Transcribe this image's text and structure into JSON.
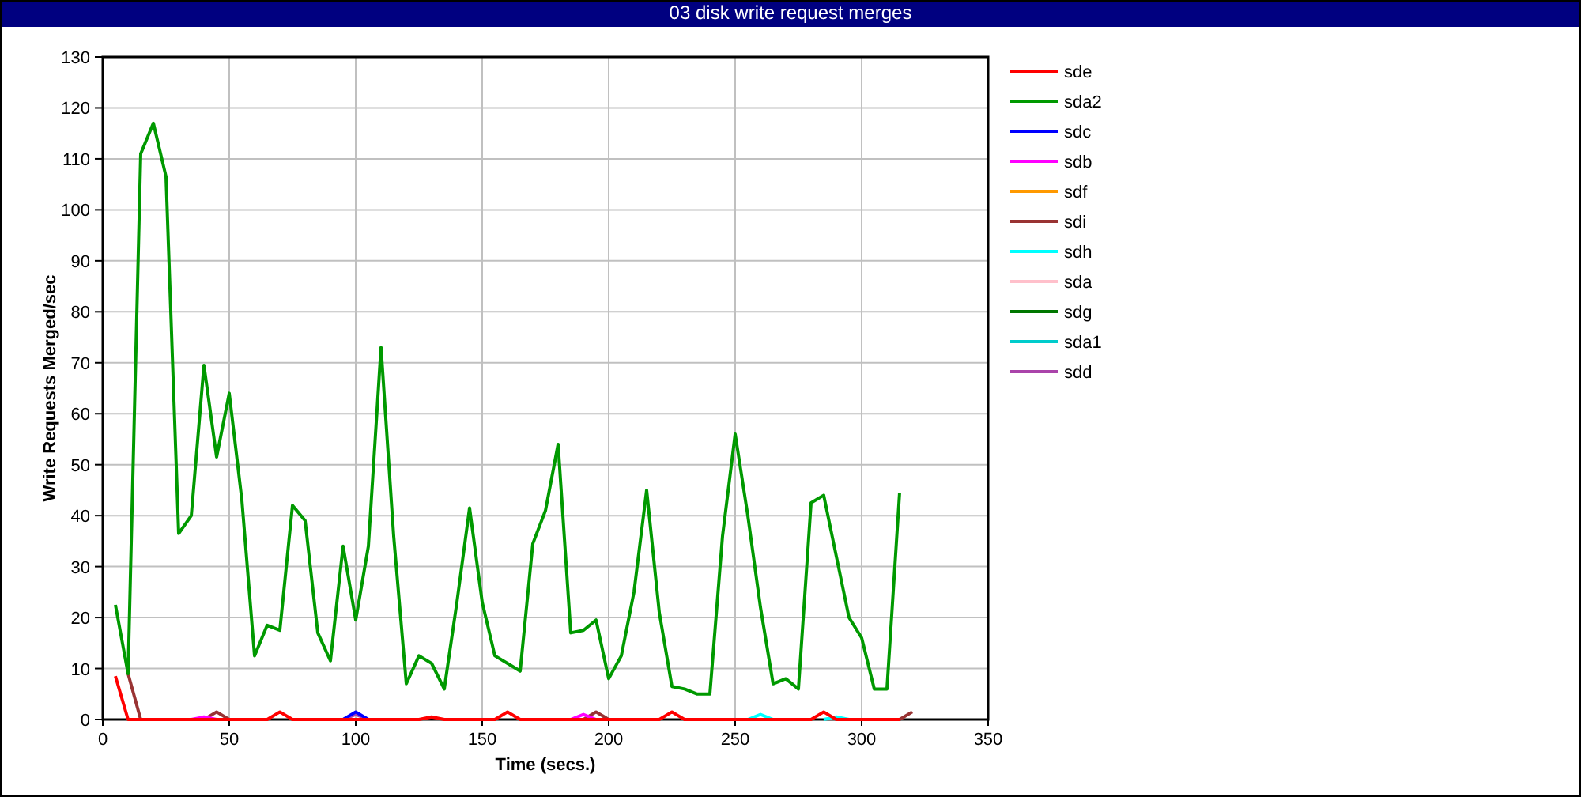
{
  "window": {
    "title": "03 disk write request merges"
  },
  "chart_data": {
    "type": "line",
    "xlabel": "Time (secs.)",
    "ylabel": "Write Requests Merged/sec",
    "xlim": [
      0,
      350
    ],
    "ylim": [
      0,
      130
    ],
    "xticks": [
      0,
      50,
      100,
      150,
      200,
      250,
      300,
      350
    ],
    "yticks": [
      0,
      10,
      20,
      30,
      40,
      50,
      60,
      70,
      80,
      90,
      100,
      110,
      120,
      130
    ],
    "x": [
      5,
      10,
      15,
      20,
      25,
      30,
      35,
      40,
      45,
      50,
      55,
      60,
      65,
      70,
      75,
      80,
      85,
      90,
      95,
      100,
      105,
      110,
      115,
      120,
      125,
      130,
      135,
      140,
      145,
      150,
      155,
      160,
      165,
      170,
      175,
      180,
      185,
      190,
      195,
      200,
      205,
      210,
      215,
      220,
      225,
      230,
      235,
      240,
      245,
      250,
      255,
      260,
      265,
      270,
      275,
      280,
      285,
      290,
      295,
      300,
      305,
      310,
      315,
      320
    ],
    "series": [
      {
        "name": "sde",
        "color": "#ff0000",
        "values": [
          8.5,
          0,
          0,
          0,
          0,
          0,
          0,
          0,
          0,
          0,
          0,
          0,
          0,
          1.5,
          0,
          0,
          0,
          0,
          0,
          0,
          0,
          0,
          0,
          0,
          0,
          0.5,
          0,
          0,
          0,
          0,
          0,
          1.5,
          0,
          0,
          0,
          0,
          0,
          0,
          0,
          0,
          0,
          0,
          0,
          0,
          1.5,
          0,
          0,
          0,
          0,
          0,
          0,
          0,
          0,
          0,
          0,
          0,
          1.5,
          0,
          0,
          0,
          0,
          0,
          0,
          null
        ]
      },
      {
        "name": "sda2",
        "color": "#009900",
        "values": [
          22.5,
          9,
          111,
          117,
          106.5,
          36.5,
          40,
          69.5,
          51.5,
          64,
          43,
          12.5,
          18.5,
          17.5,
          42,
          39,
          17,
          11.5,
          34,
          19.5,
          34,
          73,
          36,
          7,
          12.5,
          11,
          6,
          23,
          41.5,
          23,
          12.5,
          11,
          9.5,
          34.5,
          41,
          54,
          17,
          17.5,
          19.5,
          8,
          12.5,
          25,
          45,
          21,
          6.5,
          6,
          5,
          5,
          36,
          56,
          40,
          22,
          7,
          8,
          6,
          42.5,
          44,
          32,
          20,
          16,
          6,
          6,
          44.5,
          null
        ]
      },
      {
        "name": "sdc",
        "color": "#0000ff",
        "values": [
          null,
          null,
          null,
          null,
          null,
          null,
          null,
          null,
          null,
          null,
          null,
          null,
          null,
          null,
          null,
          null,
          null,
          null,
          0,
          1.5,
          0,
          null,
          null,
          null,
          null,
          null,
          null,
          null,
          null,
          null,
          null,
          null,
          null,
          null,
          null,
          null,
          null,
          null,
          null,
          null,
          null,
          null,
          null,
          null,
          null,
          null,
          null,
          null,
          null,
          null,
          null,
          null,
          null,
          null,
          null,
          null,
          null,
          null,
          null,
          null,
          null,
          null,
          null,
          null
        ]
      },
      {
        "name": "sdb",
        "color": "#ff00ff",
        "values": [
          null,
          null,
          null,
          null,
          null,
          null,
          0,
          0.5,
          0,
          null,
          null,
          null,
          null,
          null,
          null,
          null,
          null,
          null,
          null,
          null,
          null,
          null,
          null,
          null,
          null,
          null,
          null,
          null,
          null,
          null,
          null,
          null,
          null,
          null,
          null,
          null,
          0,
          1,
          0,
          null,
          null,
          null,
          null,
          null,
          null,
          null,
          null,
          null,
          null,
          null,
          null,
          null,
          null,
          null,
          null,
          null,
          null,
          null,
          null,
          null,
          null,
          null,
          null,
          null
        ]
      },
      {
        "name": "sdf",
        "color": "#ff9900",
        "values": [
          null,
          null,
          null,
          null,
          null,
          null,
          null,
          null,
          null,
          null,
          null,
          null,
          null,
          null,
          null,
          null,
          null,
          null,
          null,
          null,
          null,
          null,
          null,
          null,
          null,
          null,
          null,
          null,
          null,
          null,
          null,
          null,
          null,
          null,
          null,
          null,
          null,
          null,
          null,
          null,
          null,
          null,
          null,
          null,
          null,
          null,
          null,
          null,
          null,
          null,
          null,
          null,
          null,
          null,
          null,
          null,
          null,
          null,
          null,
          null,
          null,
          null,
          null,
          null
        ]
      },
      {
        "name": "sdi",
        "color": "#993333",
        "values": [
          null,
          9,
          0,
          null,
          null,
          null,
          null,
          0,
          1.5,
          0,
          null,
          null,
          null,
          null,
          null,
          null,
          null,
          null,
          null,
          null,
          null,
          null,
          null,
          null,
          null,
          null,
          null,
          null,
          null,
          null,
          null,
          null,
          null,
          null,
          null,
          null,
          null,
          0,
          1.5,
          0,
          null,
          null,
          null,
          null,
          null,
          null,
          null,
          null,
          null,
          null,
          null,
          null,
          null,
          null,
          null,
          null,
          null,
          null,
          null,
          null,
          null,
          null,
          0,
          1.5
        ]
      },
      {
        "name": "sdh",
        "color": "#00ffff",
        "values": [
          null,
          null,
          null,
          null,
          null,
          null,
          null,
          null,
          null,
          null,
          null,
          null,
          null,
          null,
          null,
          null,
          null,
          null,
          null,
          null,
          null,
          null,
          null,
          null,
          null,
          null,
          null,
          null,
          null,
          null,
          null,
          null,
          null,
          null,
          null,
          null,
          null,
          null,
          null,
          null,
          null,
          null,
          null,
          null,
          null,
          null,
          null,
          null,
          null,
          null,
          0,
          1,
          0,
          null,
          null,
          null,
          0,
          0.5,
          0,
          null,
          null,
          null,
          null,
          null
        ]
      },
      {
        "name": "sda",
        "color": "#ffc0cb",
        "values": [
          null,
          null,
          null,
          null,
          null,
          null,
          null,
          null,
          null,
          null,
          null,
          null,
          null,
          null,
          null,
          null,
          null,
          null,
          null,
          null,
          null,
          null,
          null,
          null,
          null,
          null,
          null,
          null,
          null,
          null,
          null,
          null,
          null,
          null,
          null,
          null,
          null,
          null,
          null,
          null,
          null,
          null,
          null,
          null,
          null,
          null,
          null,
          null,
          null,
          null,
          null,
          null,
          null,
          null,
          null,
          null,
          null,
          null,
          null,
          null,
          null,
          null,
          null,
          null
        ]
      },
      {
        "name": "sdg",
        "color": "#007700",
        "values": [
          null,
          null,
          null,
          null,
          null,
          null,
          null,
          null,
          null,
          null,
          null,
          null,
          null,
          null,
          null,
          null,
          null,
          null,
          null,
          null,
          null,
          null,
          null,
          null,
          null,
          null,
          null,
          null,
          null,
          null,
          null,
          null,
          null,
          null,
          null,
          null,
          null,
          null,
          null,
          null,
          null,
          null,
          null,
          null,
          null,
          null,
          null,
          null,
          null,
          null,
          null,
          null,
          null,
          null,
          null,
          null,
          null,
          null,
          null,
          null,
          null,
          null,
          null,
          null
        ]
      },
      {
        "name": "sda1",
        "color": "#00cccc",
        "values": [
          null,
          null,
          null,
          null,
          null,
          null,
          null,
          null,
          null,
          null,
          null,
          null,
          null,
          null,
          null,
          null,
          null,
          null,
          null,
          null,
          null,
          null,
          null,
          null,
          null,
          null,
          null,
          null,
          null,
          null,
          null,
          null,
          null,
          null,
          null,
          null,
          null,
          null,
          null,
          null,
          null,
          null,
          null,
          null,
          null,
          null,
          null,
          null,
          null,
          null,
          null,
          null,
          null,
          null,
          null,
          null,
          null,
          null,
          null,
          null,
          null,
          null,
          null,
          null
        ]
      },
      {
        "name": "sdd",
        "color": "#aa44aa",
        "values": [
          null,
          null,
          null,
          null,
          null,
          null,
          null,
          null,
          null,
          null,
          null,
          null,
          null,
          null,
          null,
          null,
          null,
          null,
          0,
          1,
          0,
          null,
          null,
          null,
          null,
          null,
          null,
          null,
          null,
          null,
          null,
          null,
          null,
          null,
          null,
          null,
          null,
          null,
          null,
          null,
          null,
          null,
          null,
          null,
          null,
          null,
          null,
          null,
          null,
          null,
          null,
          null,
          null,
          null,
          null,
          null,
          null,
          null,
          null,
          null,
          null,
          null,
          null,
          null
        ]
      }
    ],
    "grid": true,
    "legend": true
  }
}
